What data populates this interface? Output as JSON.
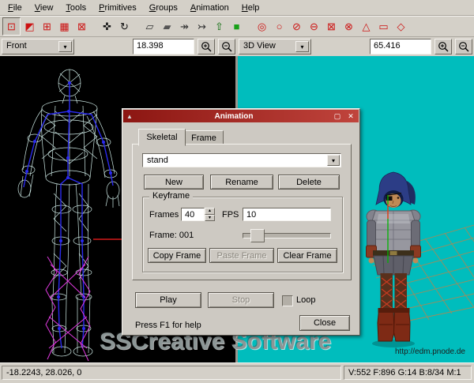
{
  "menu_bar": {
    "items": [
      "File",
      "View",
      "Tools",
      "Primitives",
      "Groups",
      "Animation",
      "Help"
    ]
  },
  "toolbar": {
    "icons": [
      {
        "name": "select-vertices-tool",
        "glyph": "⊡",
        "color": "#cc1111",
        "group": 1,
        "pressed": true
      },
      {
        "name": "select-faces-tool",
        "glyph": "◩",
        "color": "#cc1111",
        "group": 1
      },
      {
        "name": "select-connected-tool",
        "glyph": "⊞",
        "color": "#cc1111",
        "group": 1
      },
      {
        "name": "select-groups-tool",
        "glyph": "▦",
        "color": "#cc1111",
        "group": 1
      },
      {
        "name": "select-bone-joints-tool",
        "glyph": "⊠",
        "color": "#cc1111",
        "group": 1
      },
      {
        "name": "move-tool",
        "glyph": "✜",
        "color": "#111111",
        "group": 2
      },
      {
        "name": "rotate-tool",
        "glyph": "↻",
        "color": "#111111",
        "group": 2
      },
      {
        "name": "create-polygon-tool",
        "glyph": "▱",
        "color": "#333333",
        "group": 3
      },
      {
        "name": "create-quad-strip-tool",
        "glyph": "▰",
        "color": "#555555",
        "group": 3
      },
      {
        "name": "weld-vertices-tool",
        "glyph": "↠",
        "color": "#333333",
        "group": 3
      },
      {
        "name": "attach-vertices-tool",
        "glyph": "↣",
        "color": "#333333",
        "group": 3
      },
      {
        "name": "extrude-tool",
        "glyph": "⇧",
        "color": "#0a6a0a",
        "group": 3
      },
      {
        "name": "background-image-tool",
        "glyph": "■",
        "color": "#18a018",
        "group": 3
      },
      {
        "name": "torus-primitive-tool",
        "glyph": "◎",
        "color": "#cc1111",
        "group": 4
      },
      {
        "name": "sphere-primitive-tool",
        "glyph": "○",
        "color": "#cc1111",
        "group": 4
      },
      {
        "name": "geosphere-primitive-tool",
        "glyph": "⊘",
        "color": "#cc1111",
        "group": 4
      },
      {
        "name": "cylinder-primitive-tool",
        "glyph": "⊖",
        "color": "#cc1111",
        "group": 4
      },
      {
        "name": "cube-primitive-tool",
        "glyph": "⊠",
        "color": "#cc1111",
        "group": 4
      },
      {
        "name": "ellipsoid-primitive-tool",
        "glyph": "⊗",
        "color": "#cc1111",
        "group": 4
      },
      {
        "name": "cone-primitive-tool",
        "glyph": "△",
        "color": "#cc1111",
        "group": 4
      },
      {
        "name": "plane-primitive-tool",
        "glyph": "▭",
        "color": "#cc1111",
        "group": 4
      },
      {
        "name": "joint-primitive-tool",
        "glyph": "◇",
        "color": "#cc1111",
        "group": 4
      }
    ]
  },
  "viewport_controls": {
    "left": {
      "view": "Front",
      "zoom": "18.398"
    },
    "right": {
      "view": "3D View",
      "zoom": "65.416"
    }
  },
  "viewports": {
    "watermark": "SSCreative Software",
    "url": "http://edm.pnode.de"
  },
  "dialog": {
    "title": "Animation",
    "titlebar_icons": {
      "menu": "▲",
      "maximize": "▢",
      "close": "✕"
    },
    "tabs": [
      {
        "label": "Skeletal",
        "active": true
      },
      {
        "label": "Frame",
        "active": false
      }
    ],
    "animation_name": "stand",
    "buttons": {
      "new": "New",
      "rename": "Rename",
      "delete": "Delete",
      "copy": "Copy Frame",
      "paste": "Paste Frame",
      "clear": "Clear Frame",
      "play": "Play",
      "stop": "Stop",
      "close": "Close"
    },
    "keyframe": {
      "title": "Keyframe",
      "frames_label": "Frames",
      "frames_value": "40",
      "fps_label": "FPS",
      "fps_value": "10",
      "frame_label": "Frame: 001"
    },
    "loop_label": "Loop",
    "help_text": "Press F1 for help"
  },
  "status_bar": {
    "coords": "-18.2243, 28.026, 0",
    "stats": "V:552 F:896 G:14 B:8/34 M:1"
  },
  "colors": {
    "titlebar_red": "#a02420",
    "viewport_left_bg": "#000000",
    "viewport_right_bg": "#00bdbd",
    "wireframe": "#d9f6f2",
    "skeleton_blue": "#2a2af0",
    "selection_magenta": "#e03ae0",
    "tool_icon_red": "#cc1111"
  }
}
